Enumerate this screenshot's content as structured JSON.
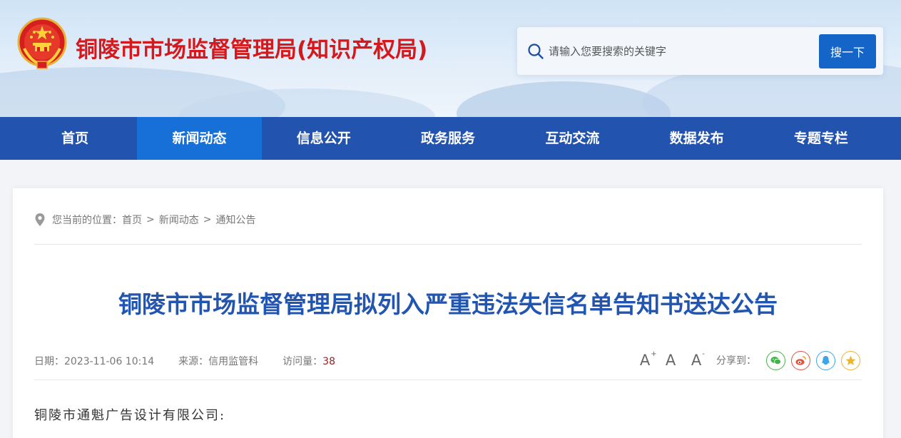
{
  "header": {
    "site_title": "铜陵市市场监督管理局(知识产权局)",
    "emblem_icon": "national-emblem-icon",
    "search": {
      "placeholder": "请输入您要搜索的关键字",
      "button_label": "搜一下",
      "icon": "search-icon"
    }
  },
  "nav": {
    "items": [
      {
        "label": "首页",
        "active": false
      },
      {
        "label": "新闻动态",
        "active": true
      },
      {
        "label": "信息公开",
        "active": false
      },
      {
        "label": "政务服务",
        "active": false
      },
      {
        "label": "互动交流",
        "active": false
      },
      {
        "label": "数据发布",
        "active": false
      },
      {
        "label": "专题专栏",
        "active": false
      }
    ]
  },
  "breadcrumb": {
    "prefix": "您当前的位置：",
    "items": [
      "首页",
      "新闻动态",
      "通知公告"
    ],
    "separator": ">"
  },
  "article": {
    "title": "铜陵市市场监督管理局拟列入严重违法失信名单告知书送达公告",
    "date": "日期：2023-11-06 10:14",
    "source": "来源：信用监管科",
    "visits_label": "访问量：",
    "visits_count": "38",
    "body_first_line": "铜陵市通魁广告设计有限公司:"
  },
  "tools": {
    "font_larger": "A",
    "font_normal": "A",
    "font_smaller": "A",
    "font_larger_mark": "+",
    "font_smaller_mark": "-",
    "share_label": "分享到："
  },
  "colors": {
    "title_red": "#d5181b",
    "nav_blue": "#2253ae",
    "nav_active": "#1770d8",
    "article_title_blue": "#2255b0",
    "search_button": "#1565c8"
  }
}
